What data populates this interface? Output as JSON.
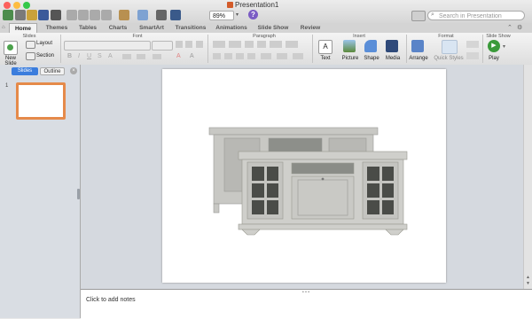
{
  "window": {
    "title": "Presentation1",
    "zoom": "89%",
    "search_placeholder": "Search in Presentation"
  },
  "ribbon_tabs": [
    "Home",
    "Themes",
    "Tables",
    "Charts",
    "SmartArt",
    "Transitions",
    "Animations",
    "Slide Show",
    "Review"
  ],
  "active_tab": "Home",
  "ribbon": {
    "groups": {
      "slides": "Slides",
      "font": "Font",
      "paragraph": "Paragraph",
      "insert": "Insert",
      "format": "Format",
      "slideshow": "Slide Show"
    },
    "new_slide": "New Slide",
    "layout": "Layout",
    "section": "Section",
    "text": "Text",
    "picture": "Picture",
    "shape": "Shape",
    "media": "Media",
    "arrange": "Arrange",
    "quick_styles": "Quick Styles",
    "play": "Play"
  },
  "panel": {
    "slides_tab": "Slides",
    "outline_tab": "Outline",
    "slide_number": "1"
  },
  "notes_placeholder": "Click to add notes",
  "colors": {
    "accent_orange": "#e58a4a",
    "tab_blue": "#3b7ddd",
    "cabinet": "#c6c6c2"
  }
}
